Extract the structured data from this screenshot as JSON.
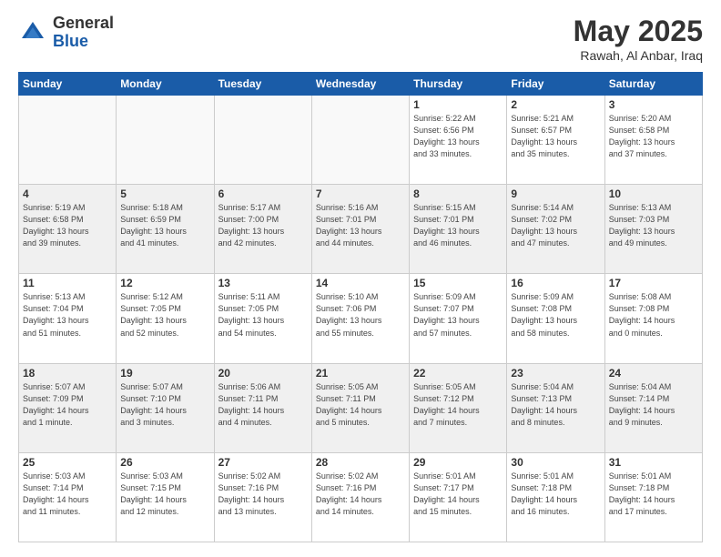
{
  "header": {
    "logo_general": "General",
    "logo_blue": "Blue",
    "month_title": "May 2025",
    "location": "Rawah, Al Anbar, Iraq"
  },
  "weekdays": [
    "Sunday",
    "Monday",
    "Tuesday",
    "Wednesday",
    "Thursday",
    "Friday",
    "Saturday"
  ],
  "weeks": [
    [
      {
        "day": "",
        "details": ""
      },
      {
        "day": "",
        "details": ""
      },
      {
        "day": "",
        "details": ""
      },
      {
        "day": "",
        "details": ""
      },
      {
        "day": "1",
        "details": "Sunrise: 5:22 AM\nSunset: 6:56 PM\nDaylight: 13 hours\nand 33 minutes."
      },
      {
        "day": "2",
        "details": "Sunrise: 5:21 AM\nSunset: 6:57 PM\nDaylight: 13 hours\nand 35 minutes."
      },
      {
        "day": "3",
        "details": "Sunrise: 5:20 AM\nSunset: 6:58 PM\nDaylight: 13 hours\nand 37 minutes."
      }
    ],
    [
      {
        "day": "4",
        "details": "Sunrise: 5:19 AM\nSunset: 6:58 PM\nDaylight: 13 hours\nand 39 minutes."
      },
      {
        "day": "5",
        "details": "Sunrise: 5:18 AM\nSunset: 6:59 PM\nDaylight: 13 hours\nand 41 minutes."
      },
      {
        "day": "6",
        "details": "Sunrise: 5:17 AM\nSunset: 7:00 PM\nDaylight: 13 hours\nand 42 minutes."
      },
      {
        "day": "7",
        "details": "Sunrise: 5:16 AM\nSunset: 7:01 PM\nDaylight: 13 hours\nand 44 minutes."
      },
      {
        "day": "8",
        "details": "Sunrise: 5:15 AM\nSunset: 7:01 PM\nDaylight: 13 hours\nand 46 minutes."
      },
      {
        "day": "9",
        "details": "Sunrise: 5:14 AM\nSunset: 7:02 PM\nDaylight: 13 hours\nand 47 minutes."
      },
      {
        "day": "10",
        "details": "Sunrise: 5:13 AM\nSunset: 7:03 PM\nDaylight: 13 hours\nand 49 minutes."
      }
    ],
    [
      {
        "day": "11",
        "details": "Sunrise: 5:13 AM\nSunset: 7:04 PM\nDaylight: 13 hours\nand 51 minutes."
      },
      {
        "day": "12",
        "details": "Sunrise: 5:12 AM\nSunset: 7:05 PM\nDaylight: 13 hours\nand 52 minutes."
      },
      {
        "day": "13",
        "details": "Sunrise: 5:11 AM\nSunset: 7:05 PM\nDaylight: 13 hours\nand 54 minutes."
      },
      {
        "day": "14",
        "details": "Sunrise: 5:10 AM\nSunset: 7:06 PM\nDaylight: 13 hours\nand 55 minutes."
      },
      {
        "day": "15",
        "details": "Sunrise: 5:09 AM\nSunset: 7:07 PM\nDaylight: 13 hours\nand 57 minutes."
      },
      {
        "day": "16",
        "details": "Sunrise: 5:09 AM\nSunset: 7:08 PM\nDaylight: 13 hours\nand 58 minutes."
      },
      {
        "day": "17",
        "details": "Sunrise: 5:08 AM\nSunset: 7:08 PM\nDaylight: 14 hours\nand 0 minutes."
      }
    ],
    [
      {
        "day": "18",
        "details": "Sunrise: 5:07 AM\nSunset: 7:09 PM\nDaylight: 14 hours\nand 1 minute."
      },
      {
        "day": "19",
        "details": "Sunrise: 5:07 AM\nSunset: 7:10 PM\nDaylight: 14 hours\nand 3 minutes."
      },
      {
        "day": "20",
        "details": "Sunrise: 5:06 AM\nSunset: 7:11 PM\nDaylight: 14 hours\nand 4 minutes."
      },
      {
        "day": "21",
        "details": "Sunrise: 5:05 AM\nSunset: 7:11 PM\nDaylight: 14 hours\nand 5 minutes."
      },
      {
        "day": "22",
        "details": "Sunrise: 5:05 AM\nSunset: 7:12 PM\nDaylight: 14 hours\nand 7 minutes."
      },
      {
        "day": "23",
        "details": "Sunrise: 5:04 AM\nSunset: 7:13 PM\nDaylight: 14 hours\nand 8 minutes."
      },
      {
        "day": "24",
        "details": "Sunrise: 5:04 AM\nSunset: 7:14 PM\nDaylight: 14 hours\nand 9 minutes."
      }
    ],
    [
      {
        "day": "25",
        "details": "Sunrise: 5:03 AM\nSunset: 7:14 PM\nDaylight: 14 hours\nand 11 minutes."
      },
      {
        "day": "26",
        "details": "Sunrise: 5:03 AM\nSunset: 7:15 PM\nDaylight: 14 hours\nand 12 minutes."
      },
      {
        "day": "27",
        "details": "Sunrise: 5:02 AM\nSunset: 7:16 PM\nDaylight: 14 hours\nand 13 minutes."
      },
      {
        "day": "28",
        "details": "Sunrise: 5:02 AM\nSunset: 7:16 PM\nDaylight: 14 hours\nand 14 minutes."
      },
      {
        "day": "29",
        "details": "Sunrise: 5:01 AM\nSunset: 7:17 PM\nDaylight: 14 hours\nand 15 minutes."
      },
      {
        "day": "30",
        "details": "Sunrise: 5:01 AM\nSunset: 7:18 PM\nDaylight: 14 hours\nand 16 minutes."
      },
      {
        "day": "31",
        "details": "Sunrise: 5:01 AM\nSunset: 7:18 PM\nDaylight: 14 hours\nand 17 minutes."
      }
    ]
  ]
}
